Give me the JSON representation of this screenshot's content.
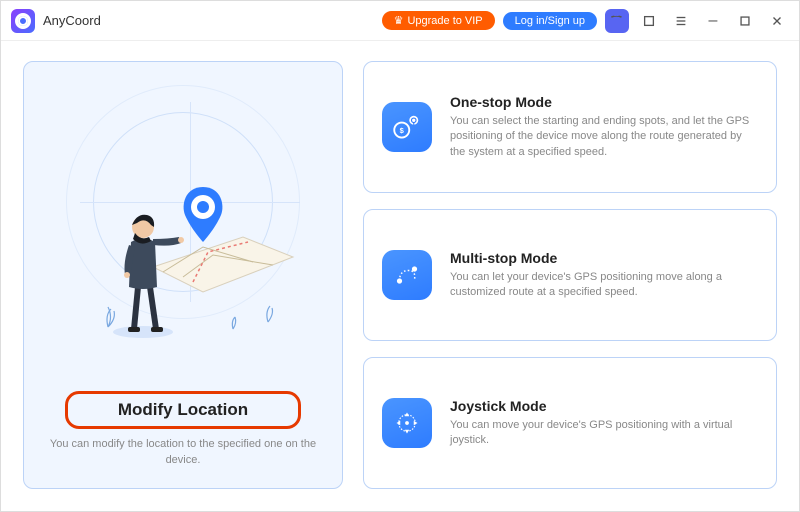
{
  "titlebar": {
    "app_name": "AnyCoord",
    "vip_label": "Upgrade to VIP",
    "login_label": "Log in/Sign up"
  },
  "left": {
    "title": "Modify Location",
    "desc": "You can modify the location to the specified one on the device."
  },
  "modes": [
    {
      "title": "One-stop Mode",
      "desc": "You can select the starting and ending spots, and let the GPS positioning of the device move along the route generated by the system at a specified speed."
    },
    {
      "title": "Multi-stop Mode",
      "desc": "You can let your device's GPS positioning move along a customized route at a specified speed."
    },
    {
      "title": "Joystick Mode",
      "desc": "You can move your device's GPS positioning with a virtual joystick."
    }
  ]
}
